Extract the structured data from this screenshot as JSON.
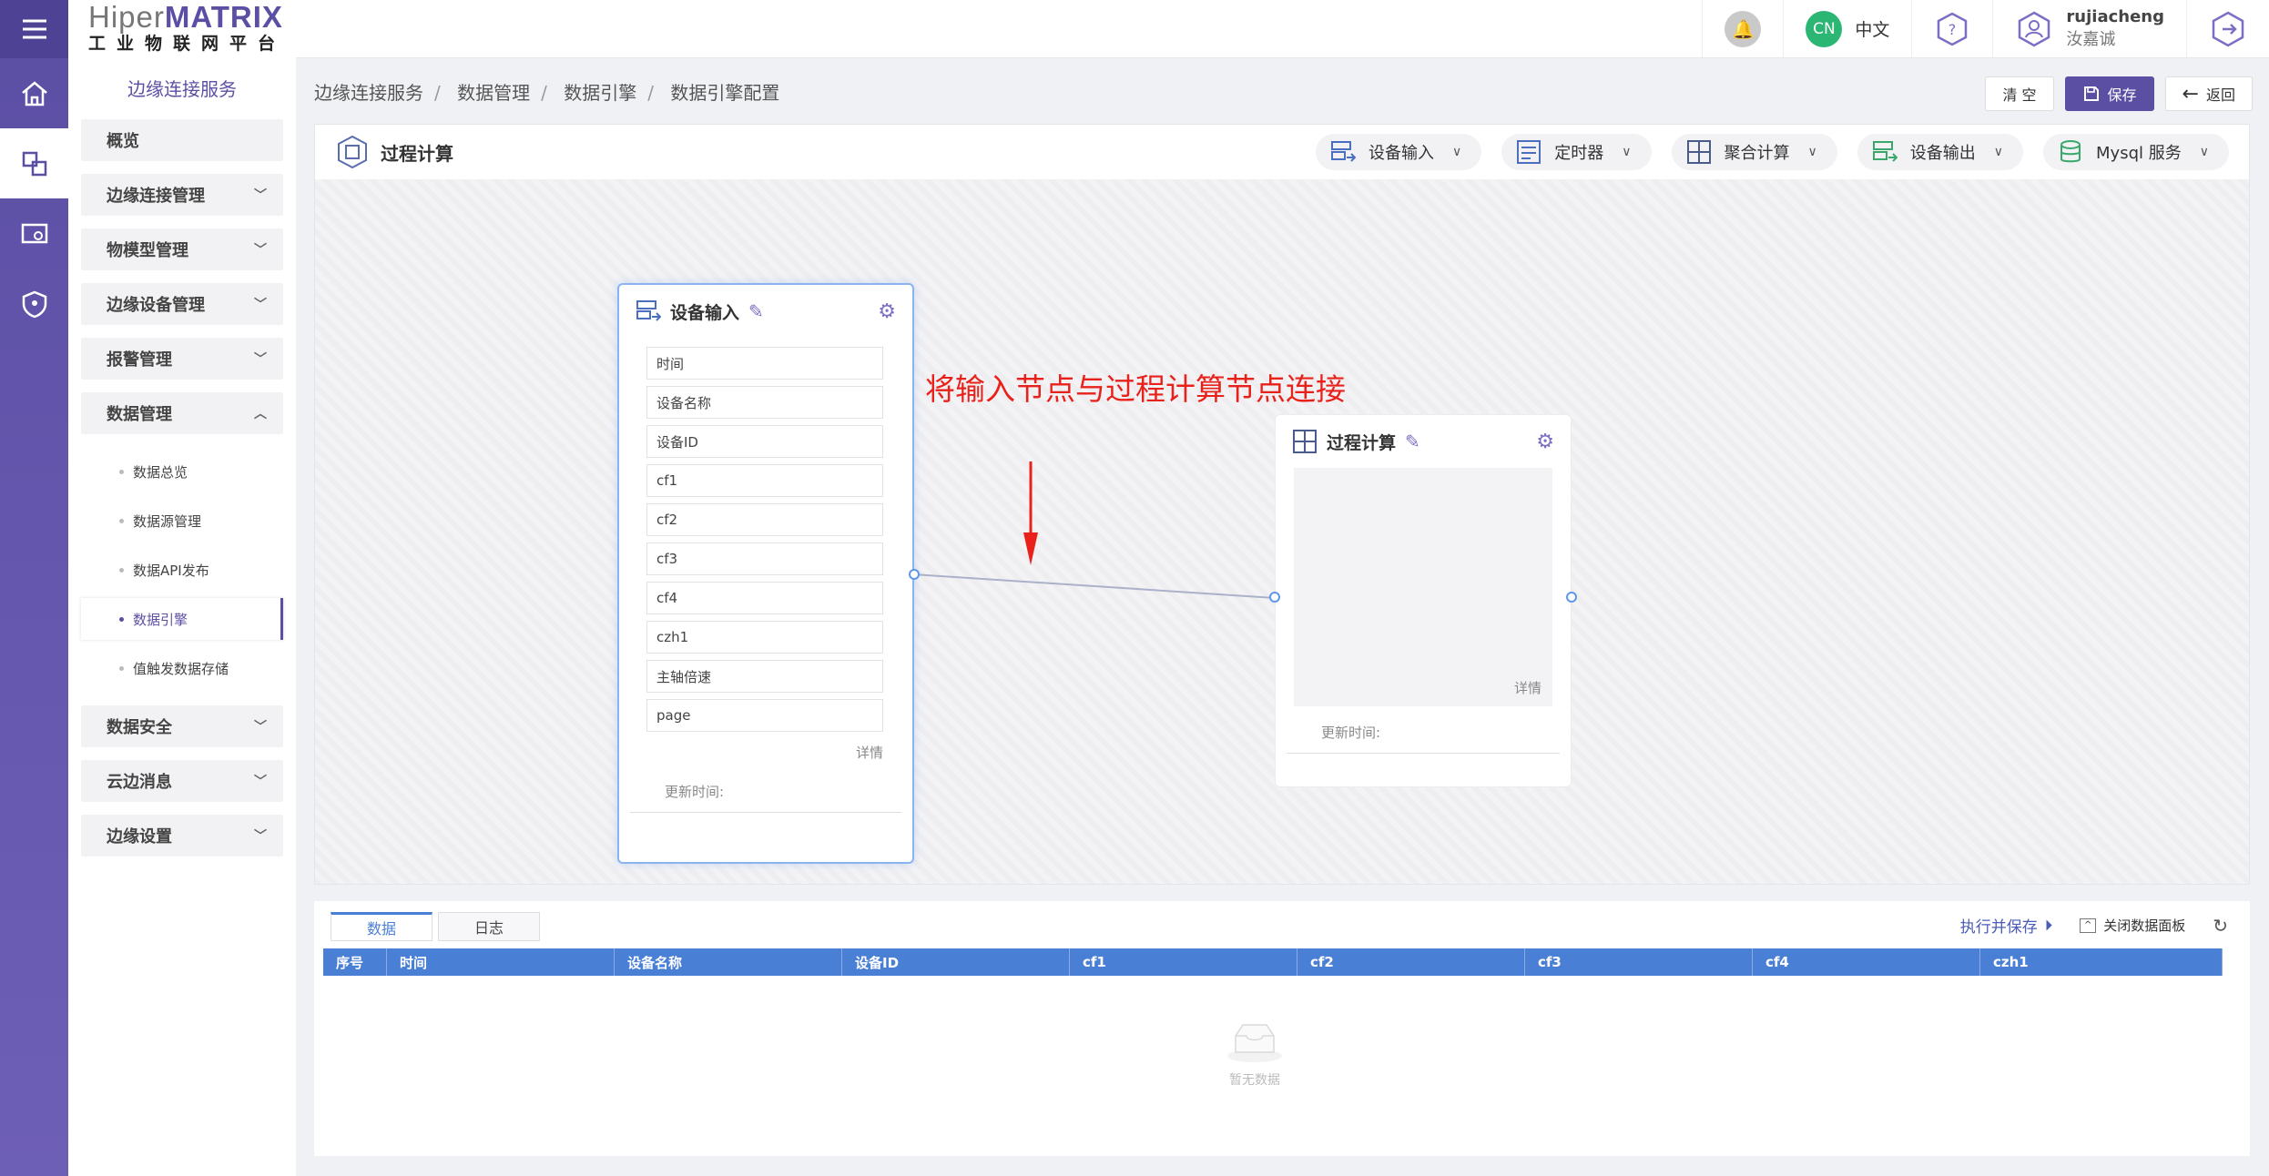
{
  "brand": {
    "logo_part1": "Hiper",
    "logo_part2": "MATRIX",
    "subtitle": "工业物联网平台"
  },
  "sidebar": {
    "service_title": "边缘连接服务",
    "items": [
      {
        "label": "概览"
      },
      {
        "label": "边缘连接管理"
      },
      {
        "label": "物模型管理"
      },
      {
        "label": "边缘设备管理"
      },
      {
        "label": "报警管理"
      },
      {
        "label": "数据管理"
      }
    ],
    "data_sub": [
      "数据总览",
      "数据源管理",
      "数据API发布",
      "数据引擎",
      "值触发数据存储"
    ],
    "items_after": [
      {
        "label": "数据安全"
      },
      {
        "label": "云边消息"
      },
      {
        "label": "边缘设置"
      }
    ]
  },
  "topbar": {
    "lang_badge": "CN",
    "lang_label": "中文",
    "user_name": "rujiacheng",
    "user_display": "汝嘉诚"
  },
  "breadcrumb": [
    "边缘连接服务",
    "数据管理",
    "数据引擎",
    "数据引擎配置"
  ],
  "actions": {
    "clear": "清 空",
    "save": "保存",
    "back": "返回"
  },
  "editor": {
    "title": "过程计算",
    "tools": [
      "设备输入",
      "定时器",
      "聚合计算",
      "设备输出",
      "Mysql 服务"
    ]
  },
  "node_input": {
    "title": "设备输入",
    "fields": [
      "时间",
      "设备名称",
      "设备ID",
      "cf1",
      "cf2",
      "cf3",
      "cf4",
      "czh1",
      "主轴倍速",
      "page"
    ],
    "detail": "详情",
    "updated": "更新时间:"
  },
  "node_calc": {
    "title": "过程计算",
    "detail": "详情",
    "updated": "更新时间:"
  },
  "annotation": "将输入节点与过程计算节点连接",
  "datapanel": {
    "tabs": [
      "数据",
      "日志"
    ],
    "run_save": "执行并保存",
    "close_panel": "关闭数据面板",
    "columns": [
      "序号",
      "时间",
      "设备名称",
      "设备ID",
      "cf1",
      "cf2",
      "cf3",
      "cf4",
      "czh1"
    ],
    "empty": "暂无数据"
  },
  "colors": {
    "accent": "#5b4fa4",
    "table_header": "#4a7fd6",
    "annotation": "#e8221b"
  }
}
